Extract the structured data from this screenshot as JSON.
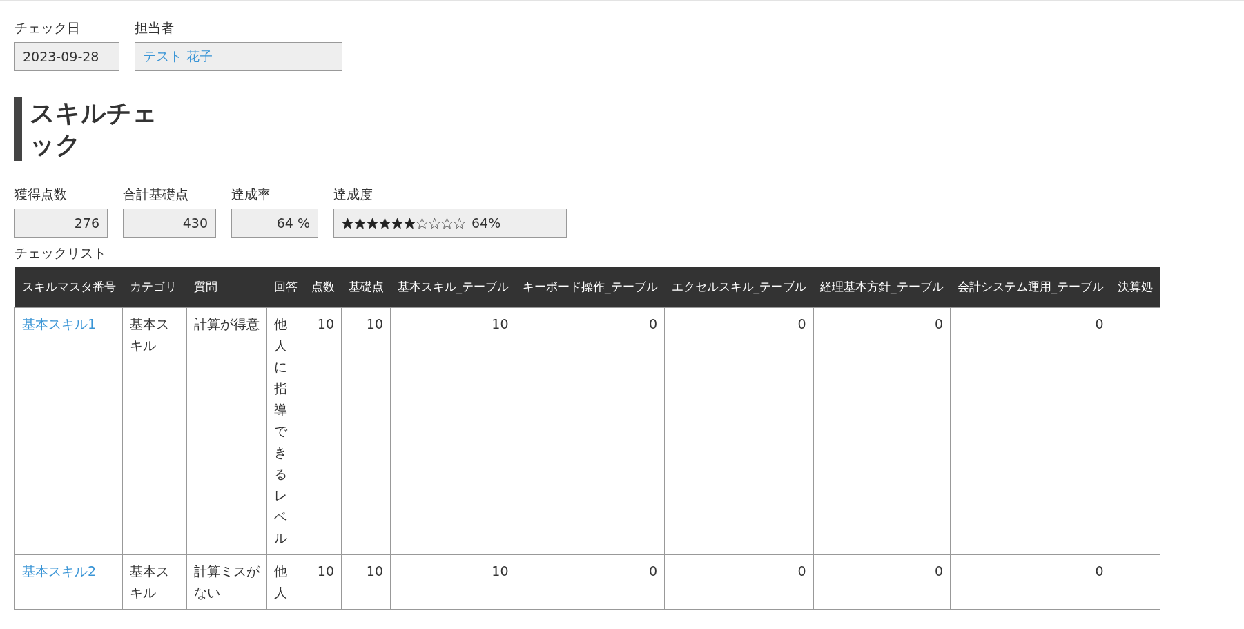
{
  "header_fields": [
    {
      "label": "チェック日",
      "value": "2023-09-28",
      "kind": "text"
    },
    {
      "label": "担当者",
      "value": "テスト 花子",
      "kind": "link"
    }
  ],
  "title": "スキルチェック",
  "stats": [
    {
      "label": "獲得点数",
      "value": "276",
      "kind": "number"
    },
    {
      "label": "合計基礎点",
      "value": "430",
      "kind": "number"
    },
    {
      "label": "達成率",
      "value": "64 %",
      "kind": "number"
    },
    {
      "label": "達成度",
      "kind": "rating",
      "stars": 6,
      "value": "64%"
    }
  ],
  "checklist": {
    "label": "チェックリスト",
    "columns": [
      "スキルマスタ番号",
      "カテゴリ",
      "質問",
      "回答",
      "点数",
      "基礎点",
      "基本スキル_テーブル",
      "キーボード操作_テーブル",
      "エクセルスキル_テーブル",
      "経理基本方針_テーブル",
      "会計システム運用_テーブル",
      "決算処"
    ],
    "rows": [
      [
        "基本スキル1",
        "基本スキル",
        "計算が得意",
        "他人に指導できるレベル",
        "10",
        "10",
        "10",
        "0",
        "0",
        "0",
        "0",
        ""
      ],
      [
        "基本スキル2",
        "基本スキル",
        "計算ミスがない",
        "他人",
        "10",
        "10",
        "10",
        "0",
        "0",
        "0",
        "0",
        ""
      ]
    ]
  }
}
